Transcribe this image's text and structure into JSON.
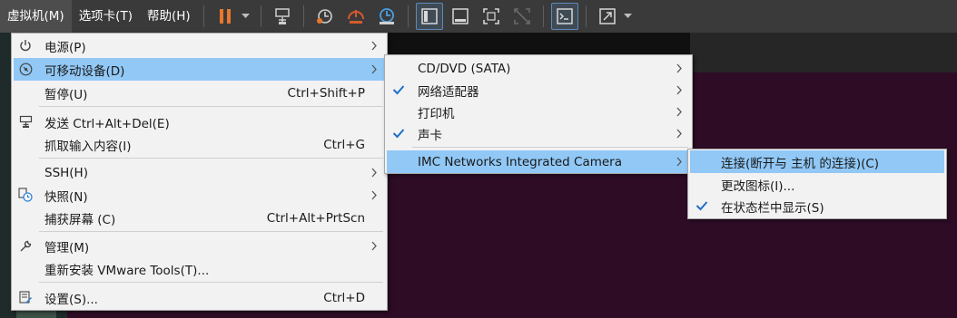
{
  "toolbar": {
    "menus": [
      {
        "label": "虚拟机(M)"
      },
      {
        "label": "选项卡(T)"
      },
      {
        "label": "帮助(H)"
      }
    ],
    "icons": [
      "pause-icon",
      "send-ctrl-alt-del-icon",
      "snapshot-icon",
      "revert-snapshot-icon",
      "snapshot-manager-icon",
      "show-library-icon",
      "thumbnail-bar-icon",
      "full-screen-icon",
      "unity-icon",
      "console-view-icon",
      "stretch-guest-icon"
    ],
    "colors": {
      "pause": "#e8772e",
      "bar_bg": "#3a3a3a"
    }
  },
  "menu_main": {
    "items": [
      {
        "label": "电源(P)",
        "shortcut": "",
        "icon": "power-icon",
        "submenu": true
      },
      {
        "label": "可移动设备(D)",
        "shortcut": "",
        "icon": "removable-devices-icon",
        "submenu": true,
        "highlighted": true
      },
      {
        "label": "暂停(U)",
        "shortcut": "Ctrl+Shift+P",
        "icon": "",
        "submenu": false
      },
      {
        "label": "发送 Ctrl+Alt+Del(E)",
        "shortcut": "",
        "icon": "send-keys-icon",
        "submenu": false
      },
      {
        "label": "抓取输入内容(I)",
        "shortcut": "Ctrl+G",
        "icon": "",
        "submenu": false
      },
      {
        "label": "SSH(H)",
        "shortcut": "",
        "icon": "",
        "submenu": true
      },
      {
        "label": "快照(N)",
        "shortcut": "",
        "icon": "snapshot-icon",
        "submenu": true
      },
      {
        "label": "捕获屏幕 (C)",
        "shortcut": "Ctrl+Alt+PrtScn",
        "icon": "",
        "submenu": false
      },
      {
        "label": "管理(M)",
        "shortcut": "",
        "icon": "wrench-icon",
        "submenu": true
      },
      {
        "label": "重新安装 VMware Tools(T)...",
        "shortcut": "",
        "icon": "",
        "submenu": false
      },
      {
        "label": "设置(S)...",
        "shortcut": "Ctrl+D",
        "icon": "settings-icon",
        "submenu": false
      }
    ]
  },
  "menu_removable": {
    "items": [
      {
        "label": "CD/DVD (SATA)",
        "checked": false
      },
      {
        "label": "网络适配器",
        "checked": true
      },
      {
        "label": "打印机",
        "checked": false
      },
      {
        "label": "声卡",
        "checked": true
      },
      {
        "label": "IMC Networks Integrated Camera",
        "checked": false,
        "highlighted": true
      }
    ]
  },
  "menu_camera": {
    "items": [
      {
        "label": "连接(断开与 主机 的连接)(C)",
        "checked": false,
        "highlighted": true
      },
      {
        "label": "更改图标(I)...",
        "checked": false
      },
      {
        "label": "在状态栏中显示(S)",
        "checked": true
      }
    ]
  },
  "colors": {
    "highlight": "#91c8f6",
    "menu_bg": "#f2f2f2",
    "check": "#1e6fc8",
    "guest_bg": "#2f0c26"
  }
}
